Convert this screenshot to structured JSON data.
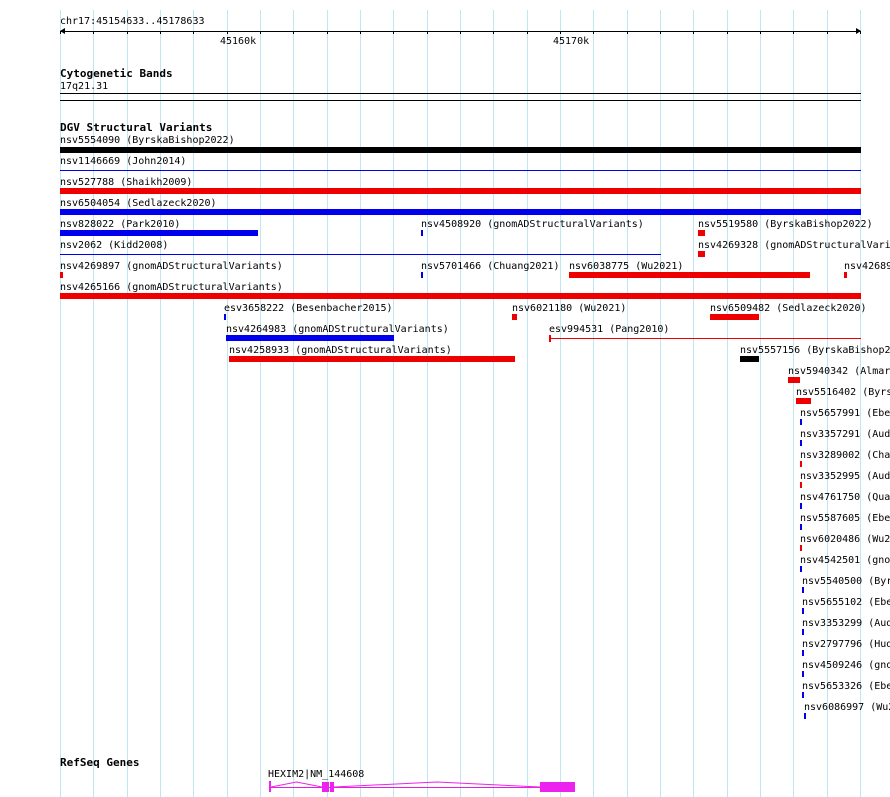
{
  "ruler": {
    "location": "chr17:45154633..45178633",
    "tick_labels": [
      "45160k",
      "45170k"
    ]
  },
  "cytoband": {
    "title": "Cytogenetic Bands",
    "band": "17q21.31"
  },
  "dgv": {
    "title": "DGV Structural Variants",
    "colors": {
      "black": "#000000",
      "red": "#ee0000",
      "blue": "#0000ee"
    },
    "variants": [
      {
        "label": "nsv5554090 (ByrskaBishop2022)",
        "color": "black"
      },
      {
        "label": "nsv1146669 (John2014)",
        "color": "blue"
      },
      {
        "label": "nsv527788 (Shaikh2009)",
        "color": "red"
      },
      {
        "label": "nsv6504054 (Sedlazeck2020)",
        "color": "blue"
      },
      {
        "label": "nsv828022 (Park2010)",
        "color": "blue"
      },
      {
        "label": "nsv4508920 (gnomADStructuralVariants)",
        "color": "blue"
      },
      {
        "label": "nsv5519580 (ByrskaBishop2022)",
        "color": "red"
      },
      {
        "label": "nsv2062 (Kidd2008)",
        "color": "blue"
      },
      {
        "label": "nsv4269328 (gnomADStructuralVari",
        "color": "red"
      },
      {
        "label": "nsv4269897 (gnomADStructuralVariants)",
        "color": "red"
      },
      {
        "label": "nsv5701466 (Chuang2021)",
        "color": "blue"
      },
      {
        "label": "nsv6038775 (Wu2021)",
        "color": "red"
      },
      {
        "label": "nsv42689",
        "color": "red"
      },
      {
        "label": "nsv4265166 (gnomADStructuralVariants)",
        "color": "red"
      },
      {
        "label": "esv3658222 (Besenbacher2015)",
        "color": "blue"
      },
      {
        "label": "nsv6021180 (Wu2021)",
        "color": "red"
      },
      {
        "label": "nsv6509482 (Sedlazeck2020)",
        "color": "red"
      },
      {
        "label": "nsv4264983 (gnomADStructuralVariants)",
        "color": "blue"
      },
      {
        "label": "esv994531 (Pang2010)",
        "color": "red"
      },
      {
        "label": "nsv4258933 (gnomADStructuralVariants)",
        "color": "red"
      },
      {
        "label": "nsv5557156 (ByrskaBishop2",
        "color": "black"
      },
      {
        "label": "nsv5940342 (Almar",
        "color": "red"
      },
      {
        "label": "nsv5516402 (Byrs",
        "color": "red"
      },
      {
        "label": "nsv5657991 (Ebe",
        "color": "blue"
      },
      {
        "label": "nsv3357291 (Aud",
        "color": "blue"
      },
      {
        "label": "nsv3289002 (Cha",
        "color": "red"
      },
      {
        "label": "nsv3352995 (Aud",
        "color": "red"
      },
      {
        "label": "nsv4761750 (Qua",
        "color": "blue"
      },
      {
        "label": "nsv5587605 (Ebe",
        "color": "blue"
      },
      {
        "label": "nsv6020486 (Wu2",
        "color": "red"
      },
      {
        "label": "nsv4542501 (gno",
        "color": "blue"
      },
      {
        "label": "nsv5540500 (Byr",
        "color": "blue"
      },
      {
        "label": "nsv5655102 (Ebe",
        "color": "blue"
      },
      {
        "label": "nsv3353299 (Aud",
        "color": "blue"
      },
      {
        "label": "nsv2797796 (Hud",
        "color": "blue"
      },
      {
        "label": "nsv4509246 (gno",
        "color": "blue"
      },
      {
        "label": "nsv5653326 (Ebe",
        "color": "blue"
      },
      {
        "label": "nsv6086997 (Wu2",
        "color": "blue"
      }
    ]
  },
  "refseq": {
    "title": "RefSeq Genes",
    "gene_label": "HEXIM2|NM_144608",
    "color": "#ee22ee"
  }
}
